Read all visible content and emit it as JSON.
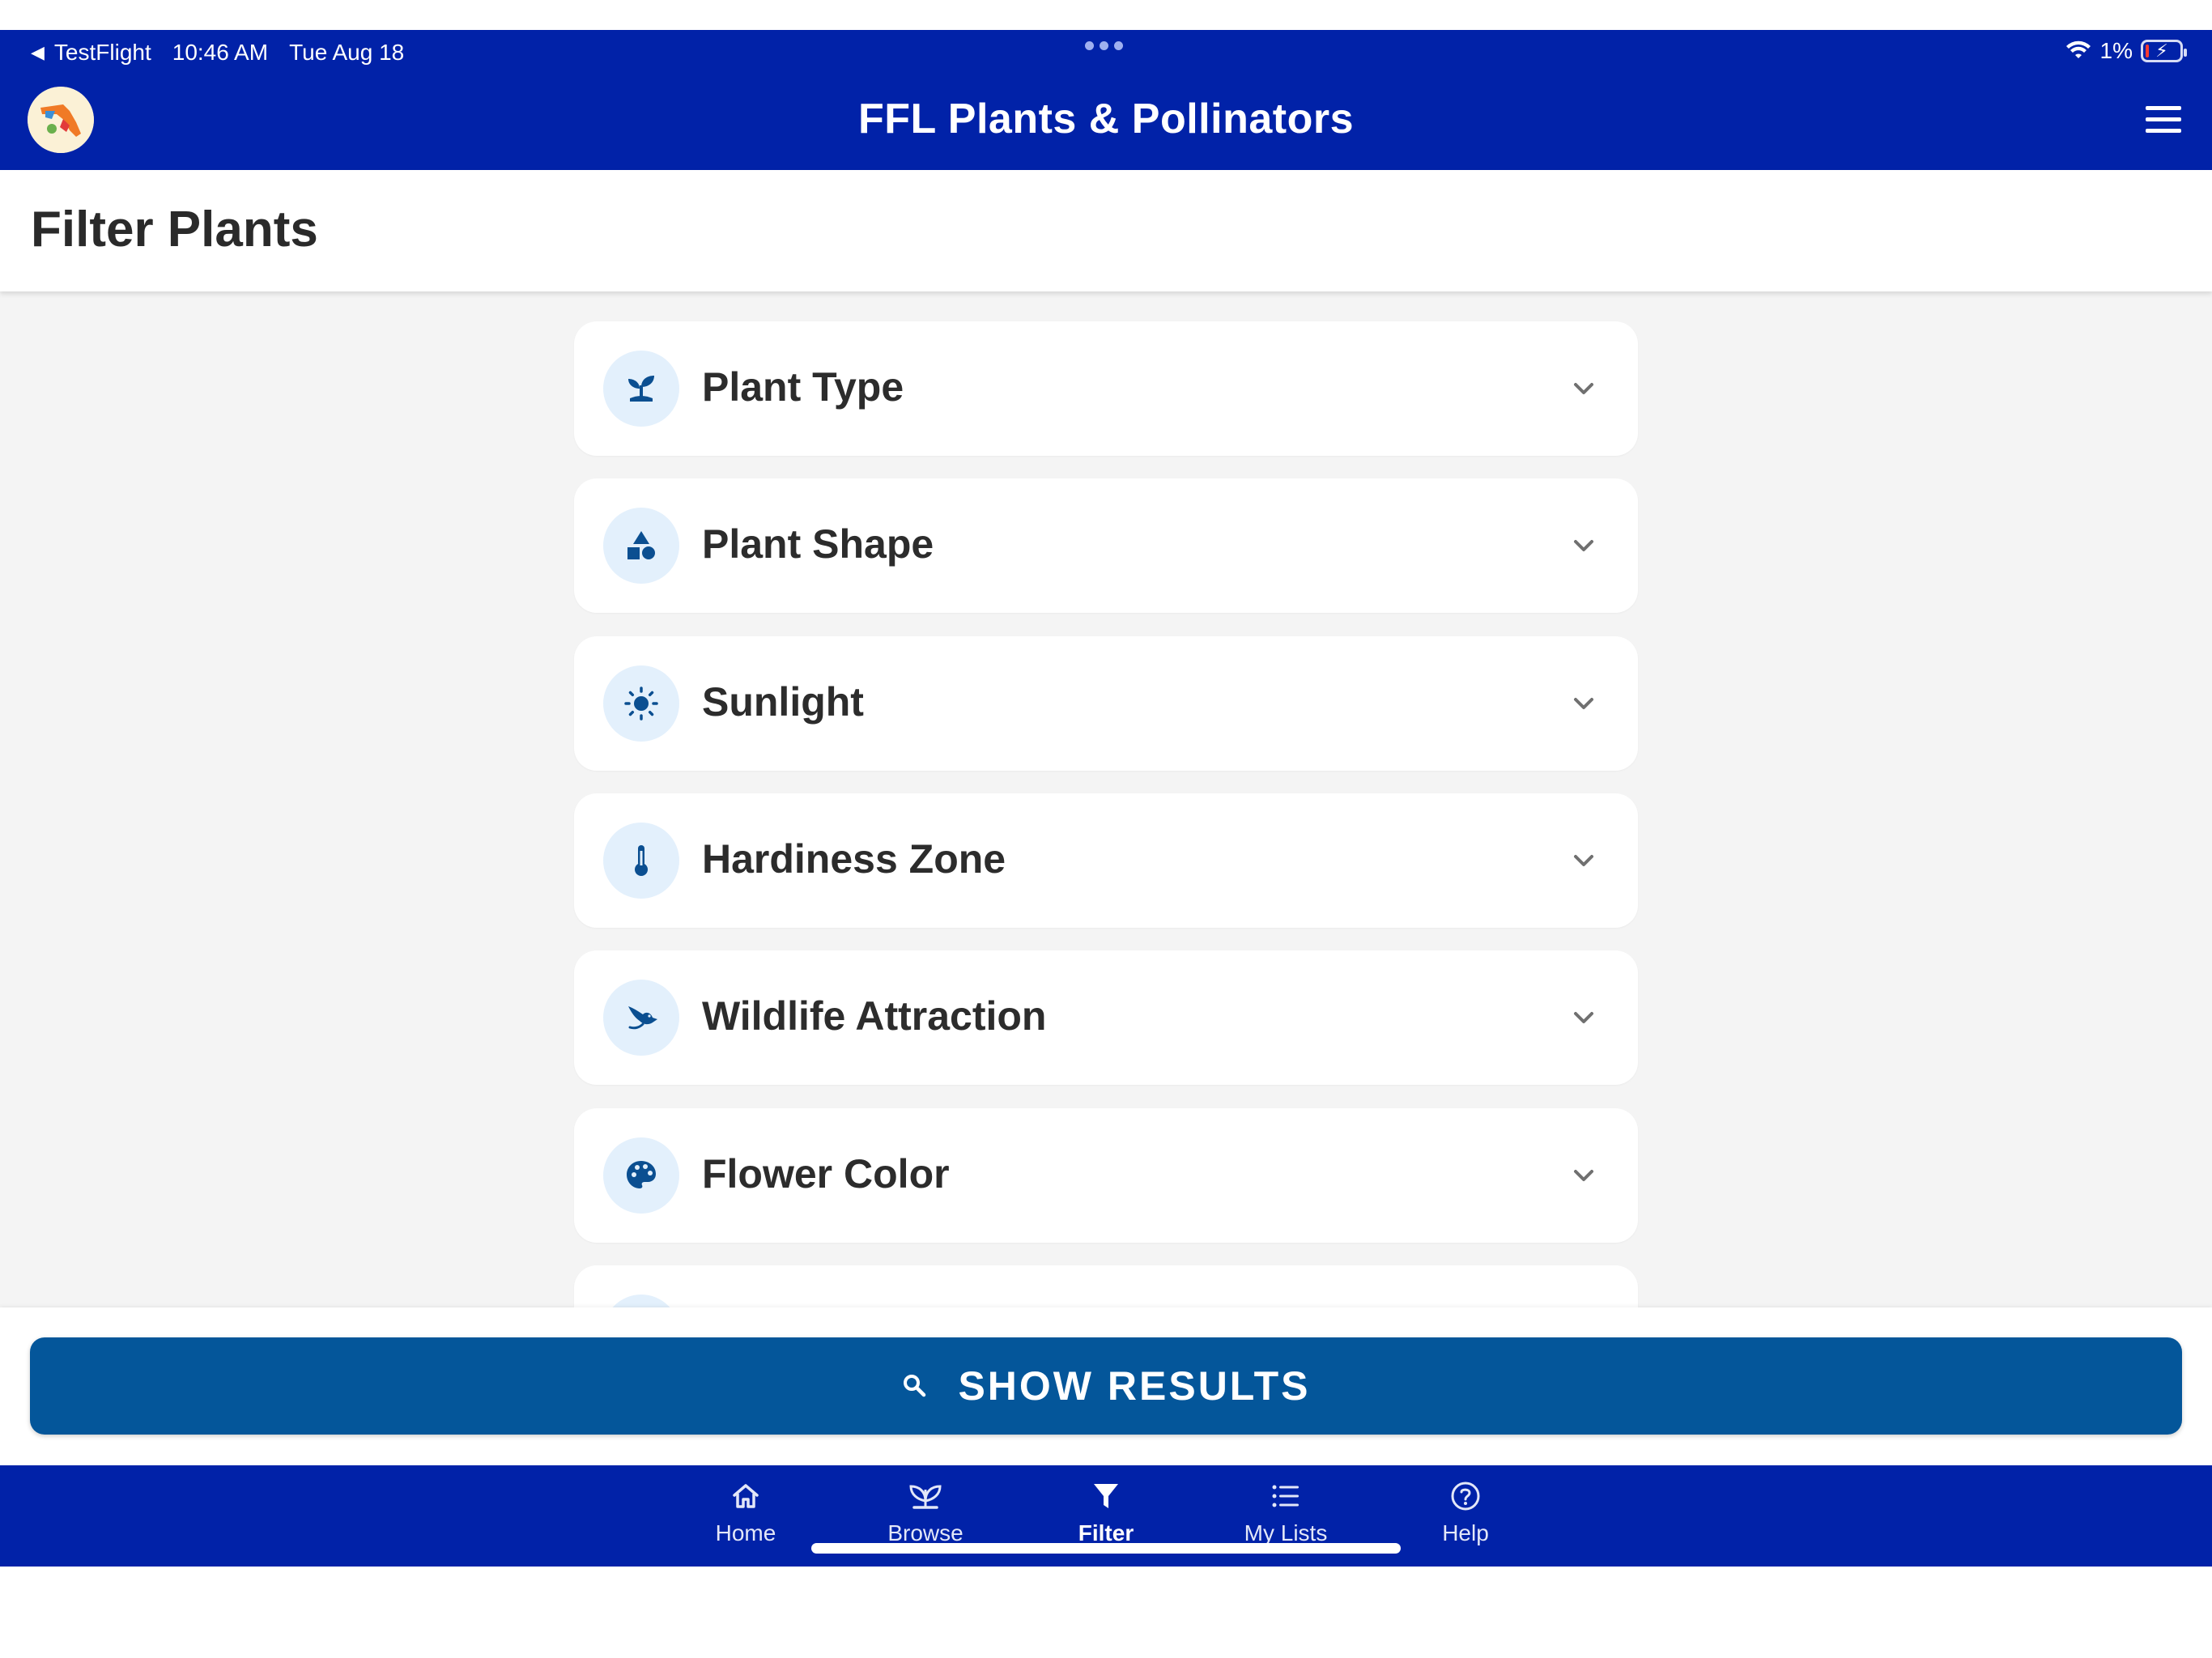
{
  "status_bar": {
    "back_app": "TestFlight",
    "time": "10:46 AM",
    "date": "Tue Aug 18",
    "battery": "1%"
  },
  "header": {
    "title": "FFL Plants & Pollinators"
  },
  "page": {
    "title": "Filter Plants"
  },
  "filters": [
    {
      "label": "Plant Type",
      "icon": "seedling-icon"
    },
    {
      "label": "Plant Shape",
      "icon": "shapes-icon"
    },
    {
      "label": "Sunlight",
      "icon": "sun-icon"
    },
    {
      "label": "Hardiness Zone",
      "icon": "thermometer-icon"
    },
    {
      "label": "Wildlife Attraction",
      "icon": "bird-icon"
    },
    {
      "label": "Flower Color",
      "icon": "palette-icon"
    }
  ],
  "action": {
    "show_results_label": "SHOW RESULTS"
  },
  "tabs": [
    {
      "label": "Home",
      "icon": "home-icon"
    },
    {
      "label": "Browse",
      "icon": "plant-icon"
    },
    {
      "label": "Filter",
      "icon": "filter-icon"
    },
    {
      "label": "My Lists",
      "icon": "list-icon"
    },
    {
      "label": "Help",
      "icon": "help-icon"
    }
  ],
  "active_tab": "Filter",
  "colors": {
    "brand_blue": "#0122a8",
    "button_blue": "#04569a",
    "icon_blue": "#0b4f91",
    "icon_bg": "#e3f0fc",
    "content_bg": "#f4f4f4"
  }
}
